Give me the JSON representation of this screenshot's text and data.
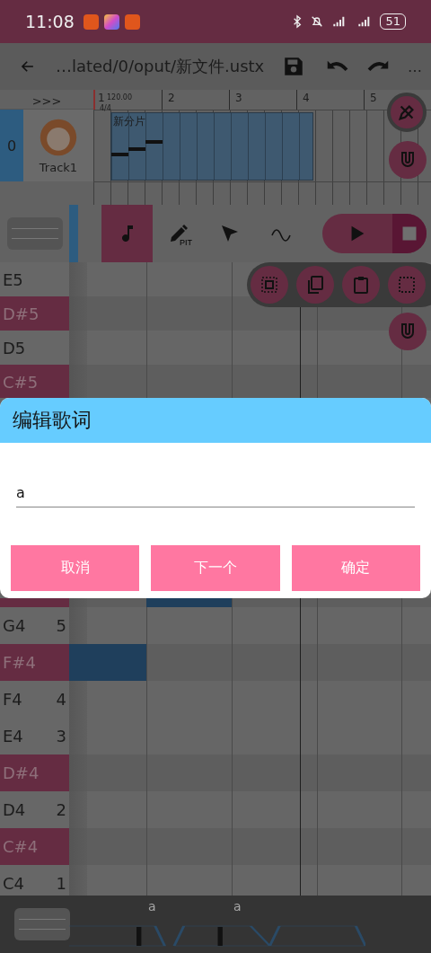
{
  "status_bar": {
    "time": "11:08",
    "battery": "51"
  },
  "toolbar": {
    "title": "…lated/0/oput/新文件.ustx",
    "more": "…"
  },
  "timeline": {
    "expand": ">>>",
    "tempo": "120.00",
    "signature": "4/4",
    "bars": [
      "1",
      "2",
      "3",
      "4",
      "5"
    ]
  },
  "track": {
    "number": "0",
    "name": "Track1",
    "part": {
      "name": "新分片"
    }
  },
  "tools": [
    {
      "kind": "note",
      "selected": true
    },
    {
      "kind": "pitch",
      "label": "PIT",
      "selected": false
    },
    {
      "kind": "select",
      "selected": false
    },
    {
      "kind": "curve",
      "selected": false
    }
  ],
  "keys_upper": [
    {
      "note": "E5",
      "black": false
    },
    {
      "note": "D#5",
      "black": true
    },
    {
      "note": "D5",
      "black": false
    },
    {
      "note": "C#5",
      "black": true
    }
  ],
  "dialog": {
    "title": "编辑歌词",
    "value": "a",
    "buttons": [
      "取消",
      "下一个",
      "确定"
    ]
  },
  "keys_lower": [
    {
      "black": true,
      "has_note": true
    },
    {
      "note": "G4",
      "number": "5",
      "black": false,
      "has_note": false
    },
    {
      "note": "F#4",
      "black": true,
      "has_note": true
    },
    {
      "note": "F4",
      "number": "4",
      "black": false
    },
    {
      "note": "E4",
      "number": "3",
      "black": false
    },
    {
      "note": "D#4",
      "black": true
    },
    {
      "note": "D4",
      "number": "2",
      "black": false
    },
    {
      "note": "C#4",
      "black": true
    },
    {
      "note": "C4",
      "number": "1",
      "black": false
    }
  ],
  "lyrics": [
    "a",
    "a"
  ]
}
